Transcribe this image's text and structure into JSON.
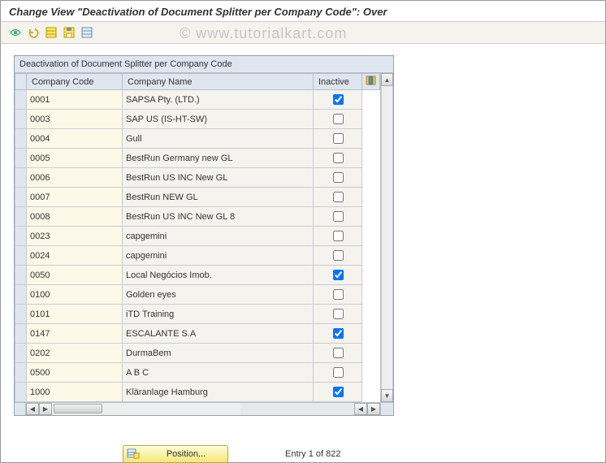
{
  "title": "Change View \"Deactivation of Document Splitter per Company Code\": Over",
  "watermark": "©   www.tutorialkart.com",
  "toolbar": {
    "icons": [
      "other-view",
      "undo",
      "select-all",
      "save",
      "deselect-all"
    ]
  },
  "panel": {
    "title": "Deactivation of Document Splitter per Company Code",
    "columns": {
      "code": "Company Code",
      "name": "Company Name",
      "inactive": "Inactive"
    },
    "rows": [
      {
        "code": "0001",
        "name": "SAPSA Pty. (LTD.)",
        "inactive": true
      },
      {
        "code": "0003",
        "name": "SAP US (IS-HT-SW)",
        "inactive": false
      },
      {
        "code": "0004",
        "name": "Gull",
        "inactive": false
      },
      {
        "code": "0005",
        "name": "BestRun Germany new GL",
        "inactive": false
      },
      {
        "code": "0006",
        "name": "BestRun US INC New GL",
        "inactive": false
      },
      {
        "code": "0007",
        "name": "BestRun NEW GL",
        "inactive": false
      },
      {
        "code": "0008",
        "name": "BestRun US INC New GL 8",
        "inactive": false
      },
      {
        "code": "0023",
        "name": "capgemini",
        "inactive": false
      },
      {
        "code": "0024",
        "name": "capgemini",
        "inactive": false
      },
      {
        "code": "0050",
        "name": "Local Negócios Imob.",
        "inactive": true
      },
      {
        "code": "0100",
        "name": "Golden eyes",
        "inactive": false
      },
      {
        "code": "0101",
        "name": "iTD Training",
        "inactive": false
      },
      {
        "code": "0147",
        "name": "ESCALANTE S.A",
        "inactive": true
      },
      {
        "code": "0202",
        "name": "DurmaBem",
        "inactive": false
      },
      {
        "code": "0500",
        "name": "A B C",
        "inactive": false
      },
      {
        "code": "1000",
        "name": "Kläranlage Hamburg",
        "inactive": true
      }
    ]
  },
  "footer": {
    "position_label": "Position...",
    "entry_text": "Entry 1 of 822"
  }
}
